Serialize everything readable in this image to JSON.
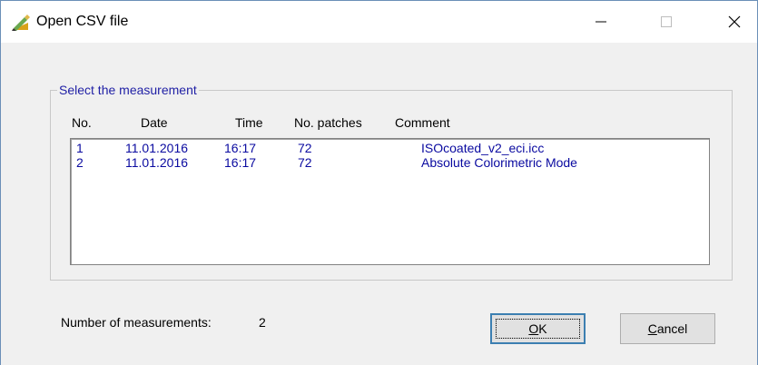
{
  "window": {
    "title": "Open CSV file",
    "icon": "pencil-ruler-icon"
  },
  "group": {
    "label": "Select the measurement"
  },
  "columns": {
    "no": "No.",
    "date": "Date",
    "time": "Time",
    "patches": "No. patches",
    "comment": "Comment"
  },
  "rows": [
    {
      "no": "1",
      "date": "11.01.2016",
      "time": "16:17",
      "patches": "72",
      "comment": "ISOcoated_v2_eci.icc"
    },
    {
      "no": "2",
      "date": "11.01.2016",
      "time": "16:17",
      "patches": "72",
      "comment": "Absolute Colorimetric Mode"
    }
  ],
  "footer": {
    "count_label": "Number of measurements:",
    "count_value": "2"
  },
  "buttons": {
    "ok_label": "OK",
    "cancel_label": "Cancel"
  },
  "colors": {
    "list_text": "#0a0aa0",
    "group_label": "#1f1fa5",
    "ok_border": "#3c7fb1"
  }
}
